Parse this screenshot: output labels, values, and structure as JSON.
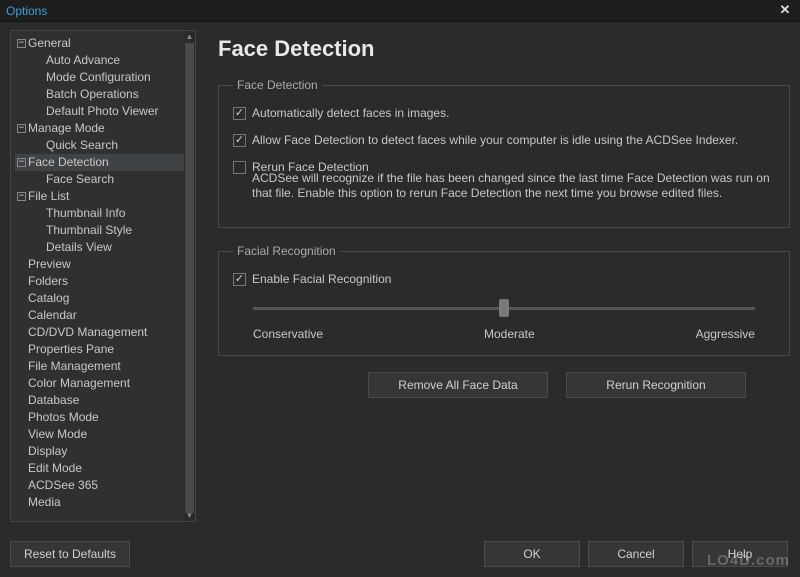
{
  "window": {
    "title": "Options",
    "close_glyph": "✕"
  },
  "sidebar": {
    "tree": [
      {
        "label": "General",
        "expanded": true,
        "children": [
          {
            "label": "Auto Advance"
          },
          {
            "label": "Mode Configuration"
          },
          {
            "label": "Batch Operations"
          },
          {
            "label": "Default Photo Viewer"
          }
        ]
      },
      {
        "label": "Manage Mode",
        "expanded": true,
        "children": [
          {
            "label": "Quick Search"
          }
        ]
      },
      {
        "label": "Face Detection",
        "expanded": true,
        "selected": true,
        "children": [
          {
            "label": "Face Search"
          }
        ]
      },
      {
        "label": "File List",
        "expanded": true,
        "children": [
          {
            "label": "Thumbnail Info"
          },
          {
            "label": "Thumbnail Style"
          },
          {
            "label": "Details View"
          }
        ]
      },
      {
        "label": "Preview"
      },
      {
        "label": "Folders"
      },
      {
        "label": "Catalog"
      },
      {
        "label": "Calendar"
      },
      {
        "label": "CD/DVD Management"
      },
      {
        "label": "Properties Pane"
      },
      {
        "label": "File Management"
      },
      {
        "label": "Color Management"
      },
      {
        "label": "Database"
      },
      {
        "label": "Photos Mode"
      },
      {
        "label": "View Mode"
      },
      {
        "label": "Display"
      },
      {
        "label": "Edit Mode"
      },
      {
        "label": "ACDSee 365"
      },
      {
        "label": "Media"
      }
    ]
  },
  "main": {
    "heading": "Face Detection",
    "groups": {
      "detection": {
        "legend": "Face Detection",
        "auto_detect": {
          "checked": true,
          "label": "Automatically detect faces in images."
        },
        "idle_detect": {
          "checked": true,
          "label": "Allow Face Detection to detect faces while your computer is idle using the ACDSee Indexer."
        },
        "rerun": {
          "checked": false,
          "label": "Rerun Face Detection",
          "desc": "ACDSee will recognize if the file has been changed since the last time Face Detection was run on that file. Enable this option to rerun Face Detection the next time you browse edited files."
        }
      },
      "recognition": {
        "legend": "Facial Recognition",
        "enable": {
          "checked": true,
          "label": "Enable Facial Recognition"
        },
        "slider": {
          "value": 1,
          "labels": [
            "Conservative",
            "Moderate",
            "Aggressive"
          ]
        }
      }
    },
    "buttons": {
      "remove": "Remove All Face Data",
      "rerun": "Rerun Recognition"
    }
  },
  "footer": {
    "reset": "Reset to Defaults",
    "ok": "OK",
    "cancel": "Cancel",
    "help": "Help"
  },
  "watermark": "LO4D.com"
}
